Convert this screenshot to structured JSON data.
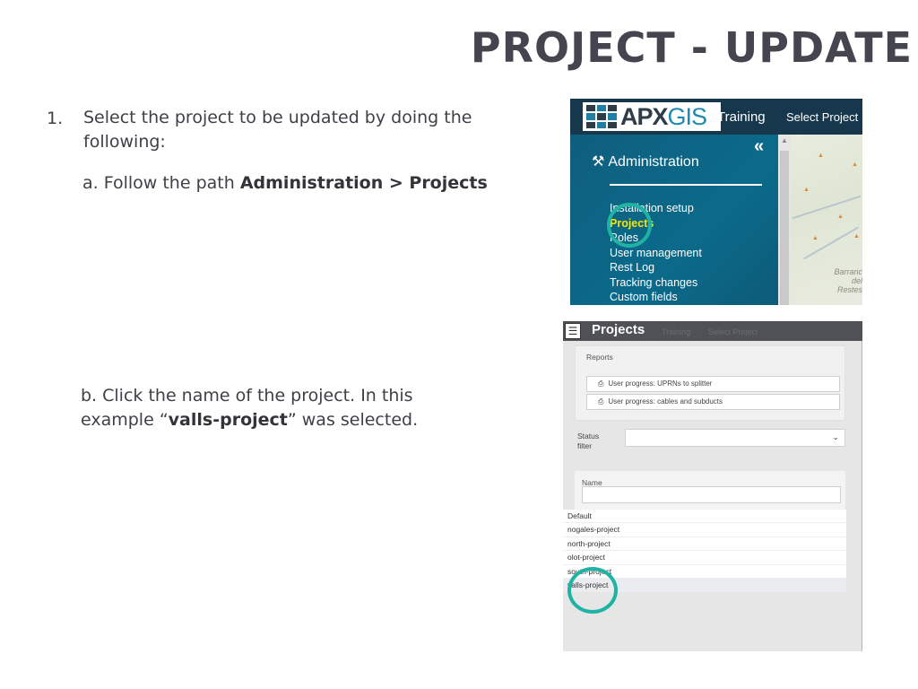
{
  "slide": {
    "title": "PROJECT - UPDATE",
    "step_number": "1.",
    "step1_text": "Select the project to be updated by doing the following:",
    "step1a_prefix": "a. Follow the path ",
    "step1a_path": "Administration > Projects",
    "step1b_prefix": "b.  Click the name of the project. In this example “",
    "step1b_project": "valls-project",
    "step1b_suffix": "” was selected."
  },
  "admin_screenshot": {
    "logo_text_dark": "APX",
    "logo_text_light": "GIS",
    "training_label": "Training",
    "select_project_label": "Select Project",
    "collapse_icon": "«",
    "heading": "Administration",
    "wrench_icon": "🔧",
    "menu_items": [
      "Installation setup",
      "Projects",
      "Roles",
      "User management",
      "Rest Log",
      "Tracking changes",
      "Custom fields"
    ],
    "active_item": "Projects",
    "map_label": "Barranc\ndel Restes",
    "colors": {
      "panel": "#0b6a8a",
      "active": "#f5e800",
      "highlight": "#1fb3a3"
    }
  },
  "projects_screenshot": {
    "title": "Projects",
    "ghost_training": "Training",
    "ghost_select": "Select Project",
    "reports_label": "Reports",
    "report_buttons": [
      "User progress: UPRNs to splitter",
      "User progress: cables and subducts"
    ],
    "status_label": "Status filter",
    "status_value": "",
    "name_label": "Name",
    "name_value": "",
    "projects": [
      "Default",
      "nogales-project",
      "north-project",
      "olot-project",
      "south-project",
      "valls-project"
    ],
    "selected_project": "valls-project"
  }
}
